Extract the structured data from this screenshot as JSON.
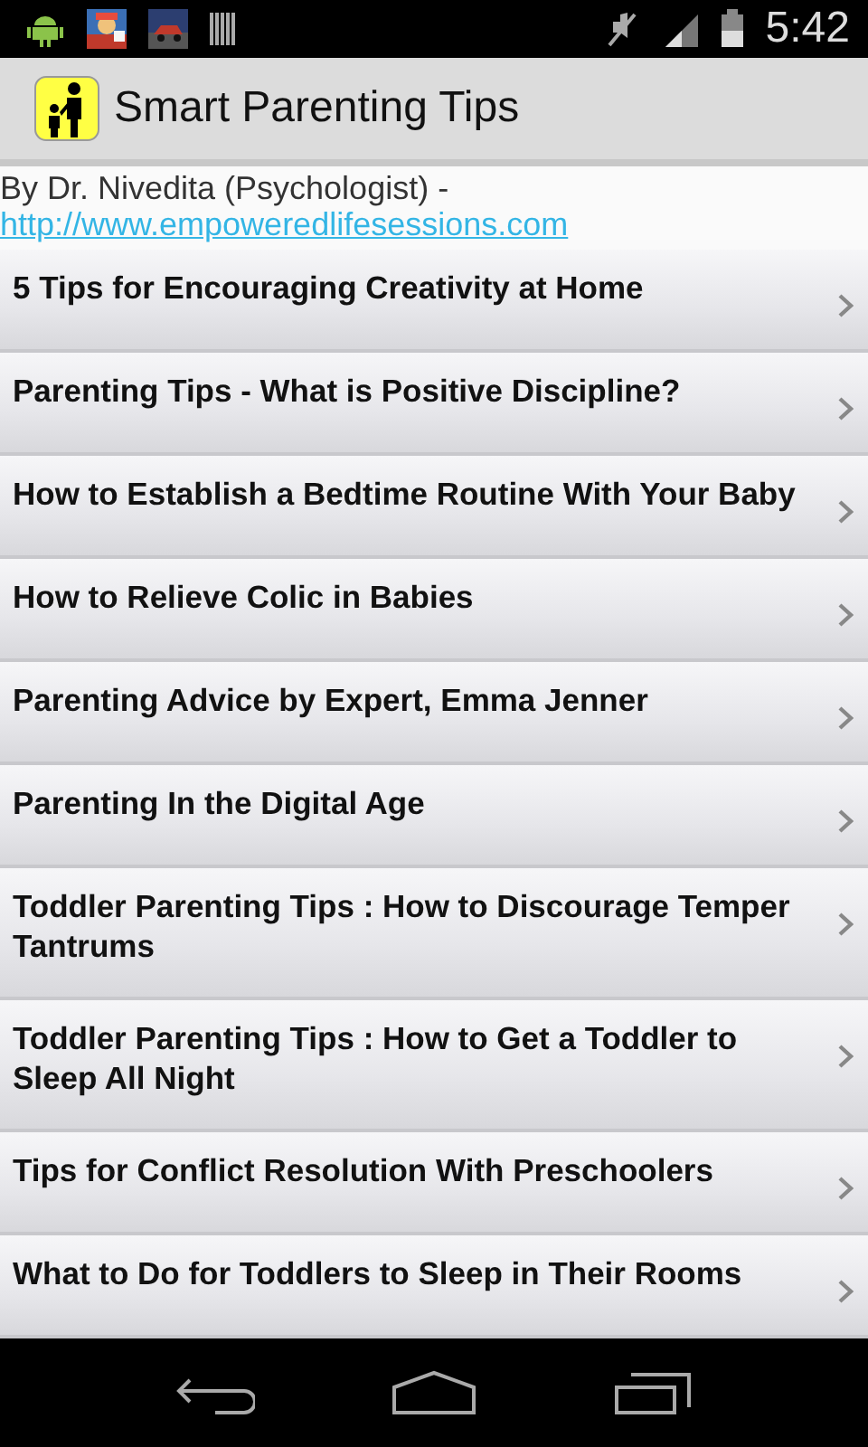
{
  "status_bar": {
    "time": "5:42"
  },
  "app_bar": {
    "title": "Smart Parenting Tips"
  },
  "byline": {
    "text": "By Dr. Nivedita (Psychologist) - ",
    "link": "http://www.empoweredlifesessions.com"
  },
  "articles": [
    {
      "title": "5 Tips for Encouraging Creativity at Home"
    },
    {
      "title": "Parenting Tips - What is Positive Discipline?"
    },
    {
      "title": "How to Establish a Bedtime Routine With Your Baby"
    },
    {
      "title": "How to Relieve Colic in Babies"
    },
    {
      "title": "Parenting Advice by Expert, Emma Jenner"
    },
    {
      "title": "Parenting In the Digital Age"
    },
    {
      "title": "Toddler Parenting Tips : How to Discourage Temper Tantrums"
    },
    {
      "title": "Toddler Parenting Tips : How to Get a Toddler to Sleep All Night"
    },
    {
      "title": "Tips for Conflict Resolution With Preschoolers"
    },
    {
      "title": "What to Do for Toddlers to Sleep in Their Rooms"
    }
  ]
}
